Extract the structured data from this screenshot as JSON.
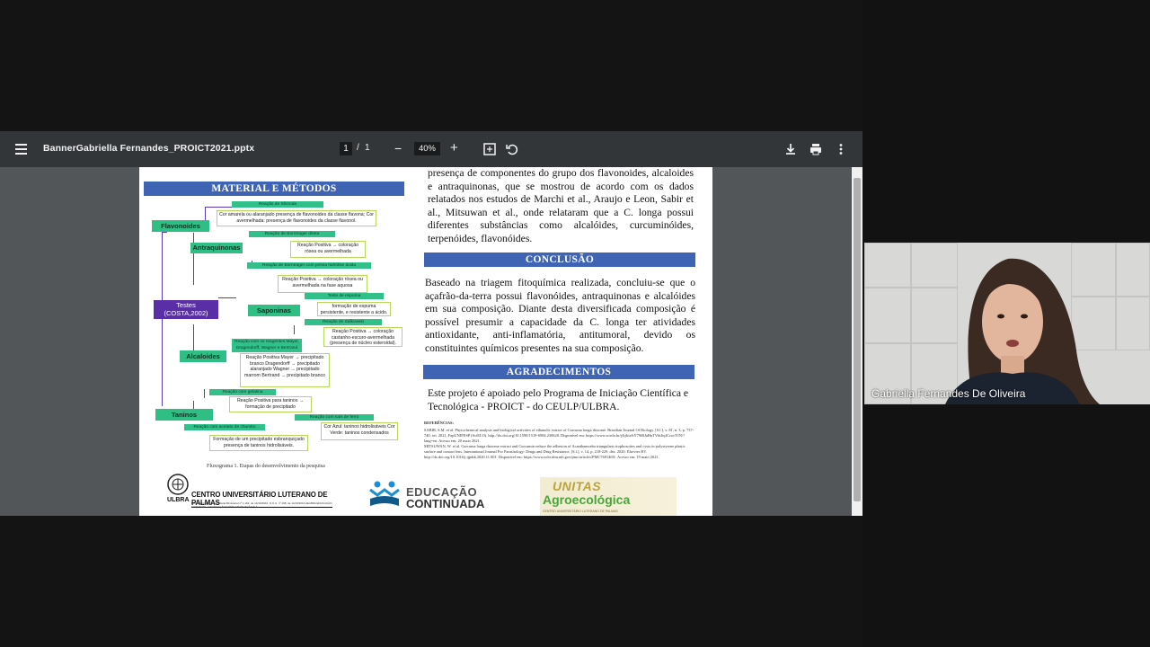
{
  "toolbar": {
    "file_name": "BannerGabriella Fernandes_PROICT2021.pptx",
    "current_page": "1",
    "page_separator": "/",
    "total_pages": "1",
    "zoom": "40%",
    "zoom_out": "−",
    "zoom_in": "+"
  },
  "poster": {
    "methods_header": "MATERIAL E MÉTODOS",
    "flow": {
      "tests": "Testes",
      "tests_ref": "(COSTA,2002)",
      "flavonoides": "Flavonoides",
      "antraquinonas": "Antraquinonas",
      "saponinas": "Saponinas",
      "alcaloides": "Alcaloides",
      "taninos": "Taninos",
      "shinoda": "Reação de Shinoda",
      "shinoda_result": "Cor amarela ou alaranjado presença de flavonoides da classe flavona; Cor avermelhada: presença de flavonoides da classe flavonol.",
      "borntrager_direta": "Reação de Borntrager direta",
      "borntrager_result": "Reação Positiva → coloração rósea ou avermelhada",
      "borntrager_hidrolise": "Reação de Borntrager com prévia hidrólise ácida",
      "borntrager_hidrolise_result": "Reação Positiva → coloração rósea ou avermelhada na fase aquosa",
      "espuma": "Teste de espuma",
      "espuma_result": "formação de espuma persistente, e resistente a ácido.",
      "salkowski": "Reação de Salkowski",
      "salkowski_result": "Reação Positiva → coloração castanho-escuro-avermelhada (presença de núcleo esteroidal).",
      "reagentes": "Reação com os reagentes Mayer, Dragendorff, Wagner e Bertrand",
      "alcaloides_result": "Reação Positiva Mayer → precipitado branco Dragendorff → precipitado alaranjado Wagner → precipitado marrom Bertrand → precipitado branco",
      "gelatina": "Reação com gelatina",
      "gelatina_result": "Reação Positiva para taninos → formação de precipitado",
      "sais_ferro": "Reação com sais de ferro",
      "sais_ferro_result": "Cor Azul: taninos hidrolisáveis Cor Verde: taninos condensados",
      "acetato": "Reação com acetato de chumbo",
      "acetato_result": "Formação de um precipitado esbranquiçado presença de taninos hidrolisáveis."
    },
    "flow_caption": "Fluxograma 1. Etapas do desenvolvimento da pesquisa",
    "results_text": "presença de componentes do grupo dos flavonoides, alcaloides e antraquinonas, que se mostrou de acordo com os dados relatados nos estudos de Marchi et al., Araujo e Leon, Sabir et al., Mitsuwan et al., onde relataram que a C. longa possui diferentes substâncias como alcalóides, curcuminóides, terpenóides, flavonóides.",
    "conclusion_header": "CONCLUSÃO",
    "conclusion_text": "Baseado na triagem fitoquímica realizada, concluiu-se que o açafrão-da-terra possui flavonóides, antraquinonas e alcalóides em sua composição. Diante desta diversificada composição é possível presumir a capacidade da C. longa ter atividades antioxidante, anti-inflamatória, antitumoral, devido os constituintes químicos presentes na sua composição.",
    "thanks_header": "AGRADECIMENTOS",
    "thanks_text": "Este projeto é apoiado pelo Programa de Iniciação Científica e Tecnológica - PROICT - do CEULP/ULBRA.",
    "refs_title": "REFERÊNCIAS:",
    "refs": [
      "SABIR, S.M. et al. Phytochemical analysis and biological activities of ethanolic extract of Curcuma longa rhizome. Brazilian Journal Of Biology. [S.l.], v. 81, n. 3, p. 737-740, set. 2021. FapUNIFESP (SciELO). http://dx.doi.org/10.1590/1519-6984.230628. Disponível em: https://www.scielo.br/j/bjb/a/hY79tBJaHuTV6iJnjfCcocYfN/?lang=en. Acesso em: 20 maio 2021.",
      "MITSUWAN, W. et al. Curcuma longa rhizome extract and Curcumin reduce the adhesion of Acanthamoeba triangularis trophozoites and cysts in polystyrene plastic surface and contact lens. International Journal For Parasitology: Drugs and Drug Resistance, [S.l.], v. 14, p. 218-229, dez. 2020. Elsevier BV. http://dx.doi.org/10.1016/j.ijpddr.2020.11.001. Disponível em: https://www.ncbi.nlm.nih.gov/pmc/articles/PMC7691469/. Acesso em: 19 maio 2021."
    ],
    "logo_ulbra": "ULBRA",
    "logo_ulbra_name": "CENTRO UNIVERSITÁRIO LUTERANO DE PALMAS",
    "logo_ulbra_sub": "Recredenciado pela Portaria Ministerial nº 1.162, de 13/10/2016, D.O.U. nº 198, de 14/10/2016 AELBRA EDUCAÇÃO SUPERIOR - GRADUAÇÃO E PÓS-GRADUAÇÃO S.A.",
    "logo_educacao_1": "EDUCAÇÃO",
    "logo_educacao_2": "CONTINUADA",
    "logo_unitas_1": "UNITAS",
    "logo_unitas_2": "Agroecológica",
    "logo_unitas_sub": "CENTRO UNIVERSITÁRIO LUTERANO DE PALMAS"
  },
  "participant": {
    "name": "Gabriella Fernandes De Oliveira"
  },
  "colors": {
    "toolbar_bg": "#323639",
    "viewer_bg": "#525659",
    "header_blue": "#3f64b3",
    "flow_green": "#2fbf84",
    "flow_purple": "#5a2ea6"
  }
}
